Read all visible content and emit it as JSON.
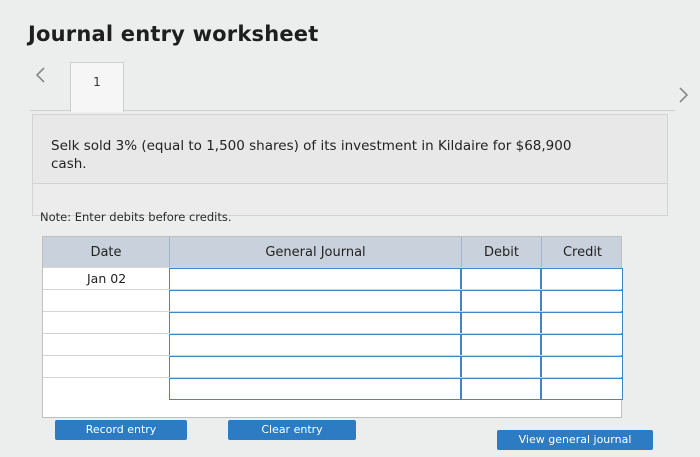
{
  "title": "Journal entry worksheet",
  "tabs": [
    {
      "label": "1"
    }
  ],
  "question": "Selk sold 3% (equal to 1,500 shares) of its investment in Kildaire for $68,900 cash.",
  "note": "Note: Enter debits before credits.",
  "table": {
    "headers": {
      "date": "Date",
      "general_journal": "General Journal",
      "debit": "Debit",
      "credit": "Credit"
    },
    "rows": [
      {
        "date": "Jan 02",
        "account": "",
        "debit": "",
        "credit": ""
      },
      {
        "date": "",
        "account": "",
        "debit": "",
        "credit": ""
      },
      {
        "date": "",
        "account": "",
        "debit": "",
        "credit": ""
      },
      {
        "date": "",
        "account": "",
        "debit": "",
        "credit": ""
      },
      {
        "date": "",
        "account": "",
        "debit": "",
        "credit": ""
      },
      {
        "date": "",
        "account": "",
        "debit": "",
        "credit": ""
      }
    ]
  },
  "buttons": {
    "record": "Record entry",
    "clear": "Clear entry",
    "view": "View general journal"
  },
  "icons": {
    "prev": "chevron-left-icon",
    "next": "chevron-right-icon"
  },
  "colors": {
    "header_bg": "#c9d1dc",
    "input_border": "#3f86c8",
    "button_bg": "#2c7bc3"
  }
}
